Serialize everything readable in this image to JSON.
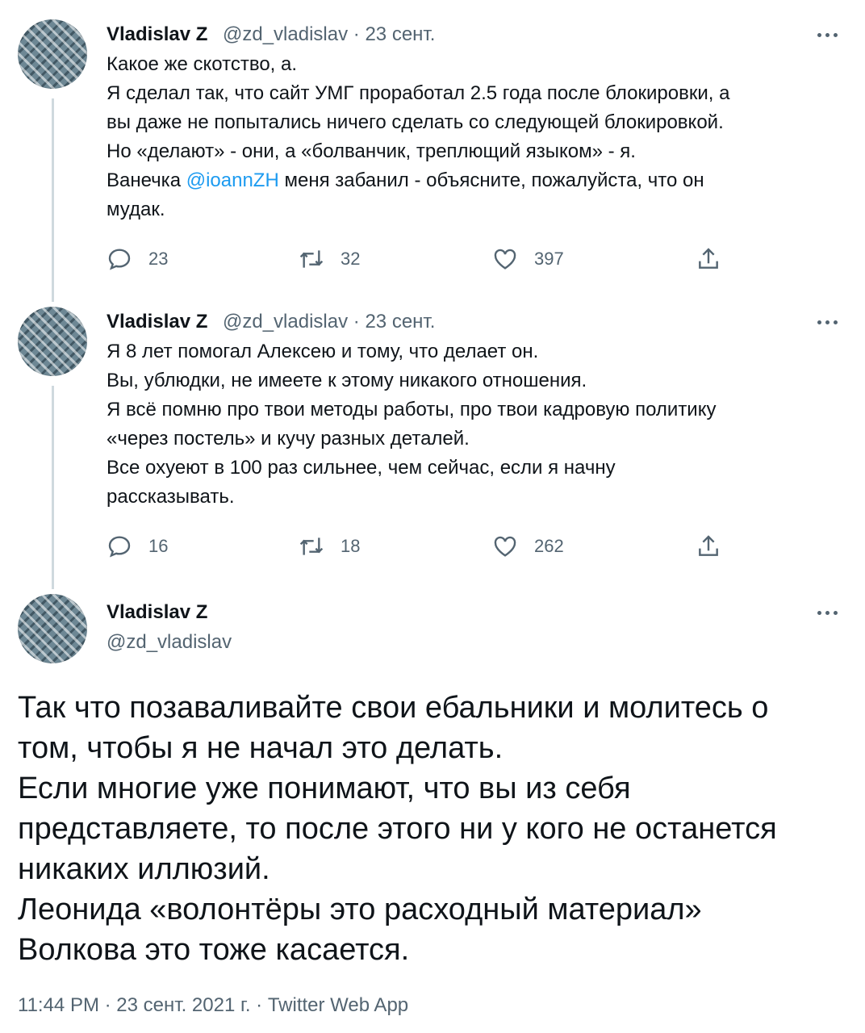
{
  "tweets": [
    {
      "author": "Vladislav Z",
      "handle": "@zd_vladislav",
      "separator": "·",
      "date": "23 сент.",
      "lines": [
        {
          "text": "Какое же скотство, а."
        },
        {
          "text": "Я сделал так, что сайт УМГ проработал 2.5 года после блокировки, а"
        },
        {
          "text": "вы даже не попытались ничего сделать со следующей блокировкой."
        },
        {
          "text": "Но «делают» - они, а «болванчик, треплющий языком» - я."
        },
        {
          "pre": "Ванечка ",
          "mention": "@ioannZH",
          "post": " меня забанил - объясните, пожалуйста, что он"
        },
        {
          "text": "мудак."
        }
      ],
      "stats": {
        "replies": "23",
        "retweets": "32",
        "likes": "397"
      }
    },
    {
      "author": "Vladislav Z",
      "handle": "@zd_vladislav",
      "separator": "·",
      "date": "23 сент.",
      "lines": [
        {
          "text": "Я 8 лет помогал Алексею и тому, что делает он."
        },
        {
          "text": "Вы, ублюдки, не имеете к этому никакого отношения."
        },
        {
          "text": "Я всё помню про твои методы работы, про твои кадровую политику"
        },
        {
          "text": "«через постель» и кучу разных деталей."
        },
        {
          "text": "Все охуеют в 100 раз сильнее, чем сейчас, если я начну"
        },
        {
          "text": "рассказывать."
        }
      ],
      "stats": {
        "replies": "16",
        "retweets": "18",
        "likes": "262"
      }
    }
  ],
  "main_tweet": {
    "author": "Vladislav Z",
    "handle": "@zd_vladislav",
    "lines": [
      "Так что позаваливайте свои ебальники и молитесь о",
      "том, чтобы я не начал это делать.",
      "Если многие уже понимают, что вы из себя",
      "представляете, то после этого ни у кого не останется",
      "никаких иллюзий.",
      "Леонида «волонтёры это расходный материал»",
      "Волкова это тоже касается."
    ],
    "time": "11:44 PM",
    "separator": "·",
    "date": "23 сент. 2021 г.",
    "separator2": "·",
    "source": "Twitter Web App"
  },
  "icons": {
    "more": "more-horizontal-icon",
    "reply": "reply-icon",
    "retweet": "retweet-icon",
    "like": "heart-icon",
    "share": "share-icon"
  },
  "colors": {
    "text": "#0f1419",
    "secondary": "#536471",
    "link": "#1d9bf0",
    "thread_line": "#cfd9de"
  }
}
